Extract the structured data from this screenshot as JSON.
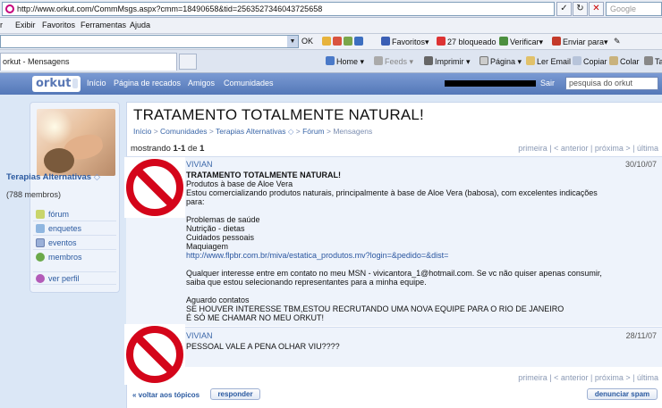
{
  "browser": {
    "url": "http://www.orkut.com/CommMsgs.aspx?cmm=18490658&tid=2563527346043725658",
    "search_placeholder": "Google",
    "menu": [
      "r",
      "Exibir",
      "Favoritos",
      "Ferramentas",
      "Ajuda"
    ],
    "toolbar": {
      "ok": "OK",
      "favoritos": "Favoritos",
      "bloqueado": "27 bloqueado",
      "verificar": "Verificar",
      "enviar": "Enviar para"
    },
    "tab_title": "orkut - Mensagens",
    "command_bar": {
      "home": "Home",
      "feeds": "Feeds",
      "imprimir": "Imprimir",
      "pagina": "Página",
      "ler_email": "Ler Email",
      "copiar": "Copiar",
      "colar": "Colar",
      "ta": "Ta"
    }
  },
  "orkut_header": {
    "logo": "orkut",
    "nav": [
      "Início",
      "Página de recados",
      "Amigos",
      "Comunidades"
    ],
    "sair": "Sair",
    "search_placeholder": "pesquisa do orkut"
  },
  "sidebar": {
    "community_name": "Terapias Alternativas",
    "member_count": "(788 membros)",
    "items": [
      "fórum",
      "enquetes",
      "eventos",
      "membros"
    ],
    "profile_link": "ver perfil"
  },
  "topic": {
    "title": "TRATAMENTO TOTALMENTE NATURAL!",
    "breadcrumb": [
      "Início",
      "Comunidades",
      "Terapias Alternativas",
      "Fórum",
      "Mensagens"
    ],
    "showing_prefix": "mostrando ",
    "showing_range": "1-1",
    "showing_of": " de ",
    "showing_total": "1",
    "pager": {
      "first": "primeira",
      "prev": "< anterior",
      "next": "próxima >",
      "last": "última",
      "sep": "|"
    }
  },
  "posts": [
    {
      "author": "VIVIAN",
      "date": "30/10/07",
      "lines": [
        "TRATAMENTO TOTALMENTE NATURAL!",
        "Produtos à base de Aloe Vera",
        "Estou comercializando produtos naturais, principalmente à base de Aloe Vera (babosa), com excelentes indicações",
        "para:",
        "",
        "Problemas de saúde",
        "Nutrição - dietas",
        "Cuidados pessoais",
        "Maquiagem",
        "http://www.flpbr.com.br/miva/estatica_produtos.mv?login=&pedido=&dist=",
        "",
        "Qualquer interesse entre em contato no meu MSN - vivicantora_1@hotmail.com. Se vc não quiser apenas consumir,",
        "saiba que estou selecionando representantes para a minha equipe.",
        "",
        "Aguardo contatos",
        "SE HOUVER INTERESSE TBM,ESTOU RECRUTANDO UMA NOVA EQUIPE PARA O RIO DE JANEIRO",
        "É SÓ ME CHAMAR NO MEU ORKUT!"
      ]
    },
    {
      "author": "VIVIAN",
      "date": "28/11/07",
      "lines": [
        "PESSOAL VALE A PENA OLHAR VIU????"
      ]
    }
  ],
  "footer": {
    "back": "« voltar aos tópicos",
    "reply": "responder",
    "report": "denunciar spam"
  }
}
